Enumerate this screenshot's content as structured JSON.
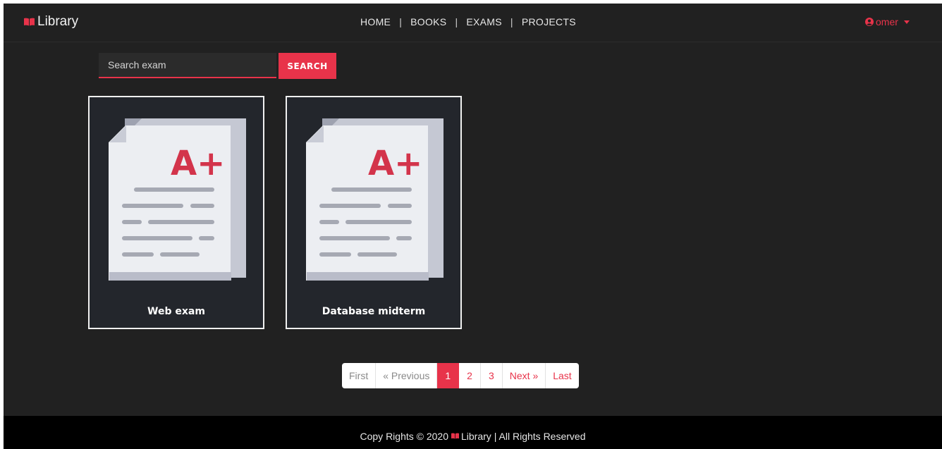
{
  "brand": {
    "name": "Library",
    "icon": "open-book-icon"
  },
  "nav": {
    "links": [
      "HOME",
      "BOOKS",
      "EXAMS",
      "PROJECTS"
    ],
    "separator": "|"
  },
  "user": {
    "name": "omer",
    "icon": "user-circle-icon",
    "caret_icon": "caret-down-icon"
  },
  "search": {
    "placeholder": "Search exam",
    "value": "",
    "button_label": "SEARCH"
  },
  "cards": [
    {
      "title": "Web exam",
      "icon": "exam-document-icon",
      "grade": "A+"
    },
    {
      "title": "Database midterm",
      "icon": "exam-document-icon",
      "grade": "A+"
    }
  ],
  "pagination": {
    "first": "First",
    "previous": "« Previous",
    "pages": [
      "1",
      "2",
      "3"
    ],
    "current": "1",
    "next": "Next »",
    "last": "Last"
  },
  "footer": {
    "before": "Copy Rights © 2020",
    "brand": "Library",
    "after": "| All Rights Reserved"
  },
  "colors": {
    "accent": "#e8334a",
    "background": "#212121",
    "footer": "#000000",
    "card": "#23262c"
  }
}
